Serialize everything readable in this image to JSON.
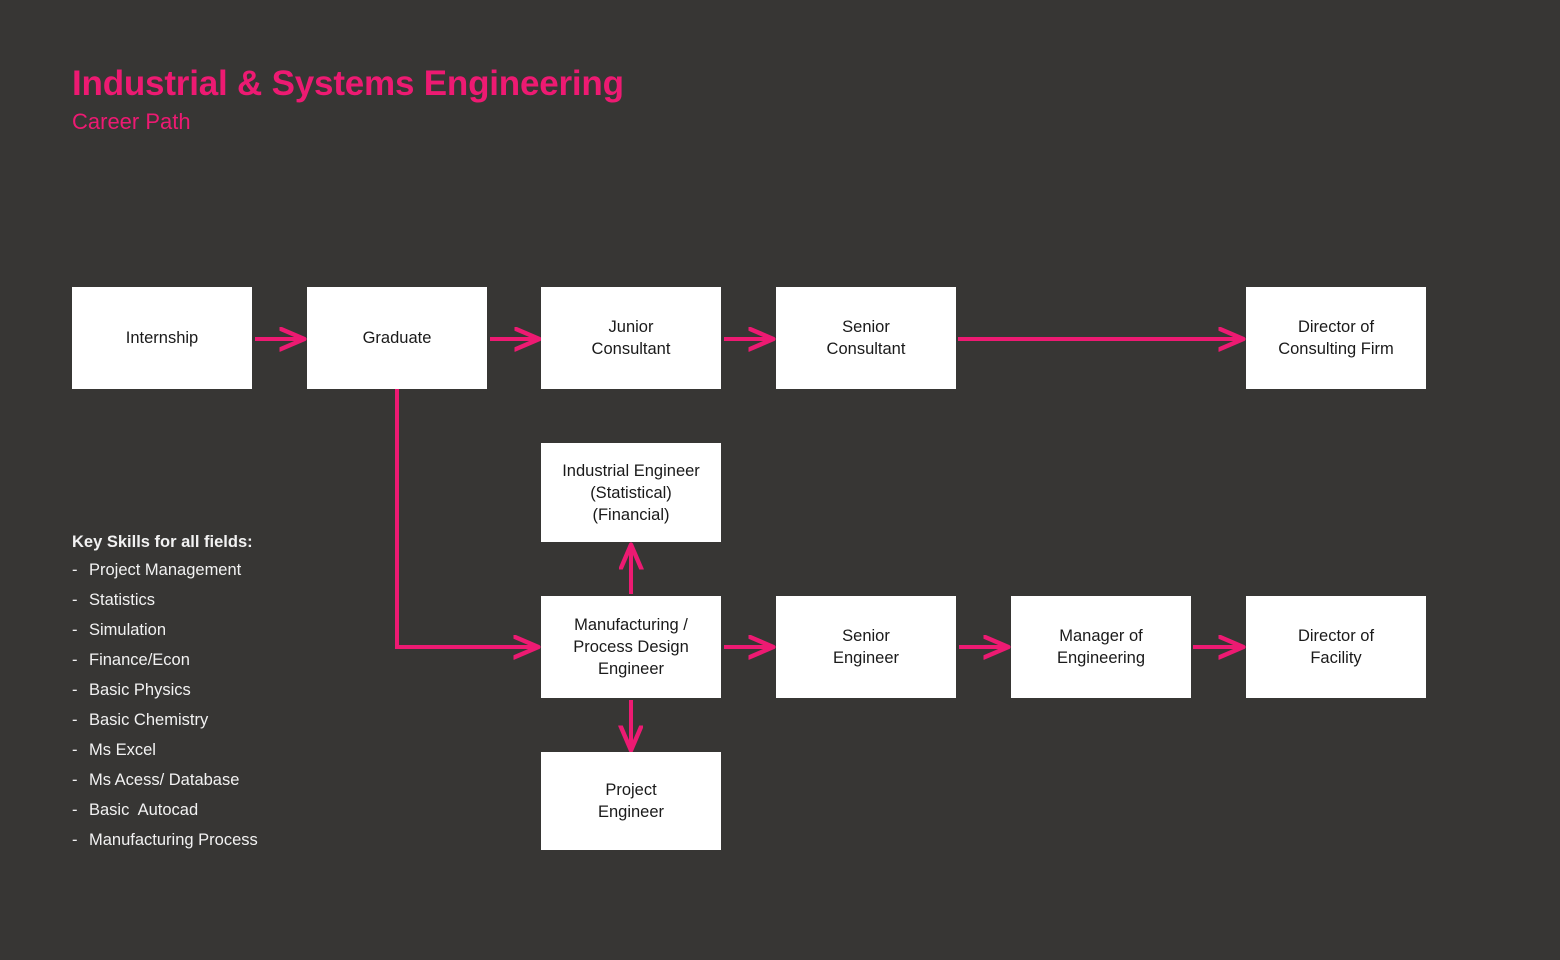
{
  "theme": {
    "background": "#373634",
    "accent": "#ED1A72",
    "node_fill": "#FFFFFF",
    "node_text": "#1A1A1A",
    "body_text": "#F2F2F2"
  },
  "header": {
    "title": "Industrial & Systems Engineering",
    "subtitle": "Career Path"
  },
  "skills": {
    "heading": "Key Skills for all fields:",
    "bullet": "-",
    "items": [
      "Project Management",
      "Statistics",
      "Simulation",
      "Finance/Econ",
      "Basic Physics",
      "Basic Chemistry",
      "Ms Excel",
      "Ms Acess/ Database",
      "Basic  Autocad",
      "Manufacturing Process"
    ]
  },
  "flow": {
    "nodes": [
      {
        "id": "internship",
        "label": "Internship"
      },
      {
        "id": "graduate",
        "label": "Graduate"
      },
      {
        "id": "junior-consultant",
        "label": "Junior\nConsultant"
      },
      {
        "id": "senior-consultant",
        "label": "Senior\nConsultant"
      },
      {
        "id": "director-consulting-firm",
        "label": "Director of\nConsulting Firm"
      },
      {
        "id": "industrial-engineer",
        "label": "Industrial Engineer\n(Statistical)\n(Financial)"
      },
      {
        "id": "manufacturing-process-design-engineer",
        "label": "Manufacturing /\nProcess Design\nEngineer"
      },
      {
        "id": "senior-engineer",
        "label": "Senior\nEngineer"
      },
      {
        "id": "manager-of-engineering",
        "label": "Manager of\nEngineering"
      },
      {
        "id": "director-of-facility",
        "label": "Director of\nFacility"
      },
      {
        "id": "project-engineer",
        "label": "Project\nEngineer"
      }
    ],
    "edges": [
      {
        "from": "internship",
        "to": "graduate",
        "direction": "right"
      },
      {
        "from": "graduate",
        "to": "junior-consultant",
        "direction": "right"
      },
      {
        "from": "junior-consultant",
        "to": "senior-consultant",
        "direction": "right"
      },
      {
        "from": "senior-consultant",
        "to": "director-consulting-firm",
        "direction": "right"
      },
      {
        "from": "graduate",
        "to": "manufacturing-process-design-engineer",
        "direction": "elbow-down-right"
      },
      {
        "from": "manufacturing-process-design-engineer",
        "to": "industrial-engineer",
        "direction": "up"
      },
      {
        "from": "manufacturing-process-design-engineer",
        "to": "project-engineer",
        "direction": "down"
      },
      {
        "from": "manufacturing-process-design-engineer",
        "to": "senior-engineer",
        "direction": "right"
      },
      {
        "from": "senior-engineer",
        "to": "manager-of-engineering",
        "direction": "right"
      },
      {
        "from": "manager-of-engineering",
        "to": "director-of-facility",
        "direction": "right"
      }
    ]
  }
}
